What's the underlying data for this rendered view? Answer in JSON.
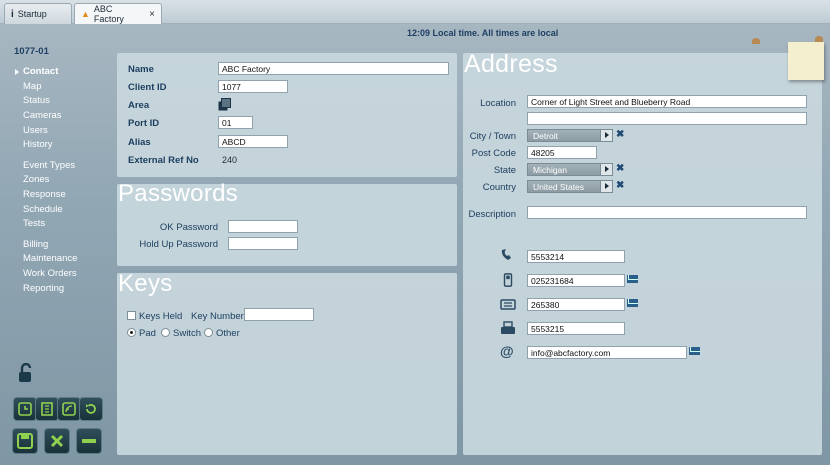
{
  "tabs": [
    {
      "label": "Startup",
      "icon": "info-icon"
    },
    {
      "label": "ABC Factory",
      "icon": "person-icon"
    }
  ],
  "clock_text": "12:09 Local time. All times are local",
  "nav": {
    "site_id": "1077-01",
    "group1": [
      "Contact",
      "Map",
      "Status",
      "Cameras",
      "Users",
      "History"
    ],
    "group2": [
      "Event Types",
      "Zones",
      "Response",
      "Schedule",
      "Tests"
    ],
    "group3": [
      "Billing",
      "Maintenance",
      "Work Orders",
      "Reporting"
    ]
  },
  "general": {
    "name_label": "Name",
    "name_value": "ABC Factory",
    "client_id_label": "Client ID",
    "client_id_value": "1077",
    "area_label": "Area",
    "port_id_label": "Port ID",
    "port_id_value": "01",
    "alias_label": "Alias",
    "alias_value": "ABCD",
    "ext_ref_label": "External Ref No",
    "ext_ref_value": "240"
  },
  "passwords": {
    "title": "Passwords",
    "ok_label": "OK Password",
    "ok_value": "",
    "holdup_label": "Hold Up Password",
    "holdup_value": ""
  },
  "keys": {
    "title": "Keys",
    "keys_held_label": "Keys Held",
    "key_number_label": "Key Number",
    "key_number_value": "",
    "options": [
      "Pad",
      "Switch",
      "Other"
    ],
    "selected_option": "Pad"
  },
  "address": {
    "title": "Address",
    "location_label": "Location",
    "location_line1": "Corner of Light Street and Blueberry Road",
    "location_line2": "",
    "city_label": "City / Town",
    "city_value": "Detroit",
    "postcode_label": "Post Code",
    "postcode_value": "48205",
    "state_label": "State",
    "state_value": "Michigan",
    "country_label": "Country",
    "country_value": "United States",
    "description_label": "Description",
    "description_value": ""
  },
  "contacts": {
    "phone": "5553214",
    "mobile": "025231684",
    "fax": "265380",
    "telephone2": "5553215",
    "email": "info@abcfactory.com"
  },
  "colors": {
    "panel": "#c8d7de",
    "title_text": "#ffffff",
    "label_text": "#1b3d5e",
    "accent": "#1f4a73"
  }
}
